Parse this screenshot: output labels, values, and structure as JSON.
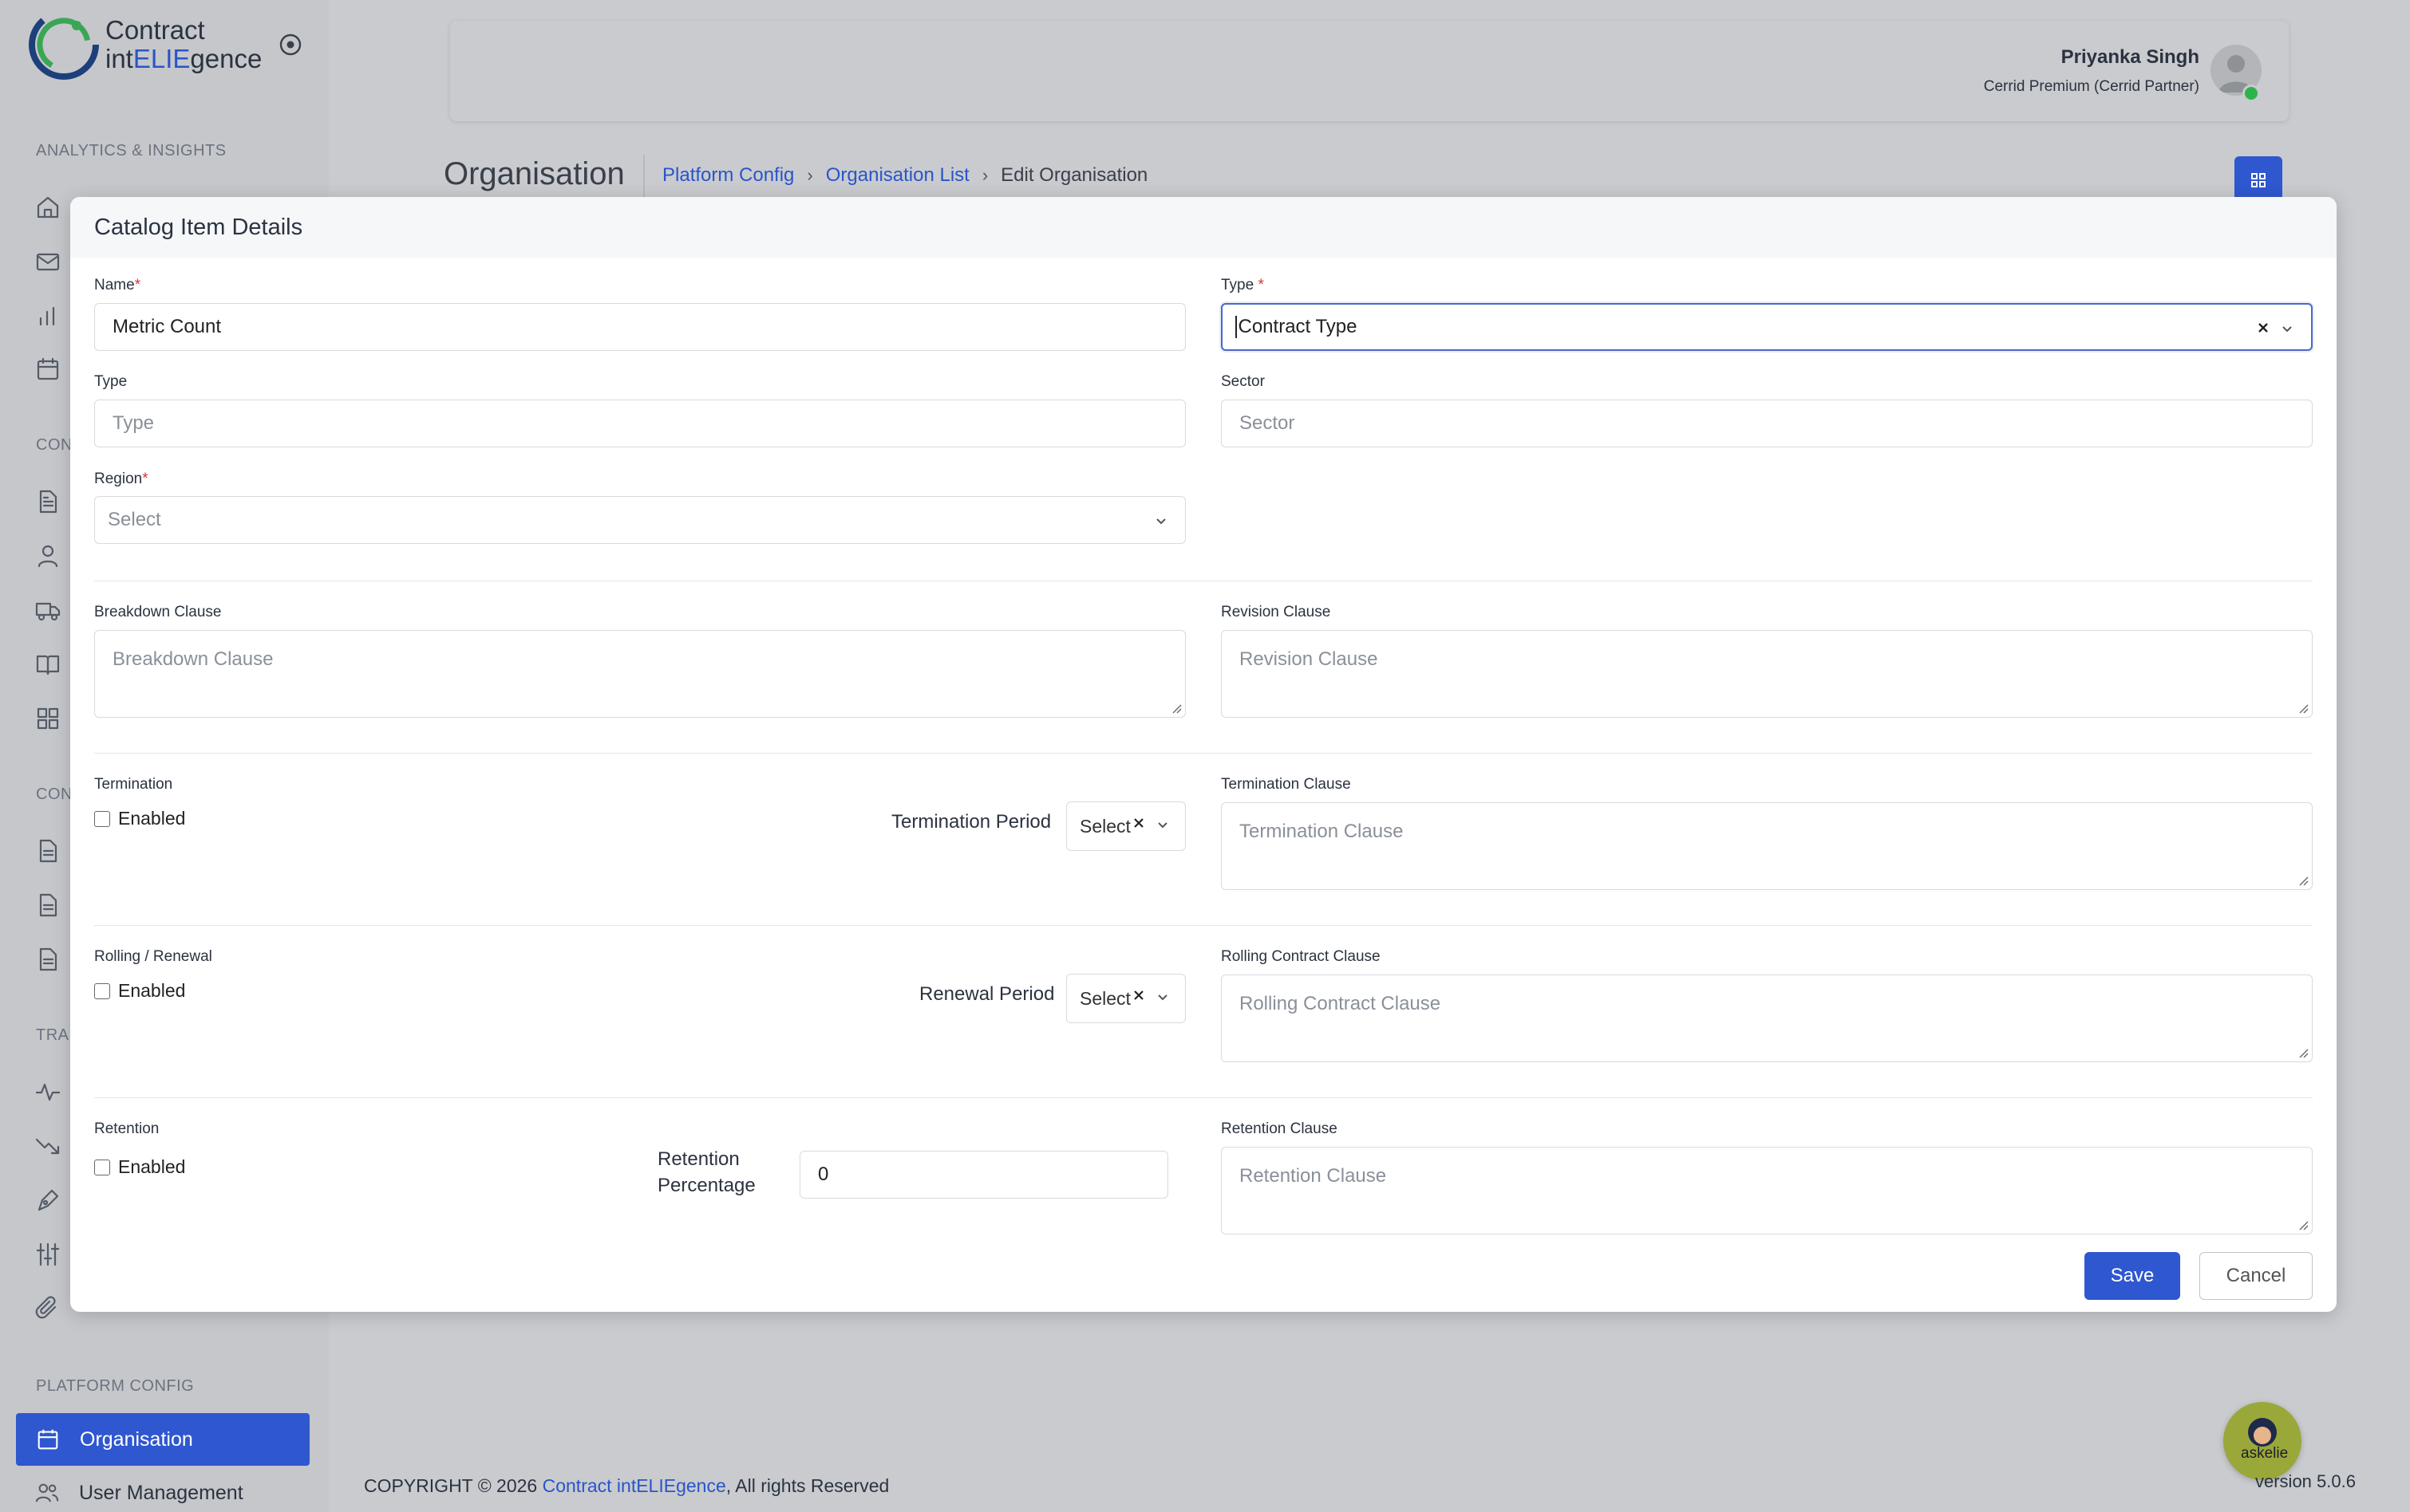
{
  "brand": {
    "logo_line1": "Contract",
    "logo_line2_pre": "int",
    "logo_line2_acc": "ELIE",
    "logo_line2_post": "gence"
  },
  "sidebar": {
    "headings": {
      "analytics": "ANALYTICS & INSIGHTS",
      "con1": "CON",
      "con2": "CON",
      "track": "TRA",
      "platform": "PLATFORM CONFIG"
    },
    "active_item": {
      "label": "Organisation",
      "icon": "calendar-icon"
    },
    "items": [
      {
        "label": "User Management",
        "icon": "users-icon"
      }
    ]
  },
  "header": {
    "user_name": "Priyanka Singh",
    "user_role": "Cerrid Premium (Cerrid Partner)",
    "page_title": "Organisation",
    "breadcrumb": [
      "Platform Config",
      "Organisation List",
      "Edit Organisation"
    ]
  },
  "modal": {
    "title": "Catalog Item Details",
    "name": {
      "label": "Name",
      "value": "Metric Count"
    },
    "type_select": {
      "label": "Type",
      "value": "Contract Type"
    },
    "type_input": {
      "label": "Type",
      "placeholder": "Type"
    },
    "sector": {
      "label": "Sector",
      "placeholder": "Sector"
    },
    "region": {
      "label": "Region",
      "placeholder": "Select"
    },
    "breakdown": {
      "label": "Breakdown Clause",
      "placeholder": "Breakdown Clause"
    },
    "revision": {
      "label": "Revision Clause",
      "placeholder": "Revision Clause"
    },
    "termination": {
      "label": "Termination",
      "checkbox": "Enabled",
      "period_label": "Termination Period",
      "period_value": "Select",
      "clause_label": "Termination Clause",
      "clause_placeholder": "Termination Clause"
    },
    "rolling": {
      "label": "Rolling / Renewal",
      "checkbox": "Enabled",
      "period_label": "Renewal Period",
      "period_value": "Select",
      "clause_label": "Rolling Contract Clause",
      "clause_placeholder": "Rolling Contract Clause"
    },
    "retention": {
      "label": "Retention",
      "checkbox": "Enabled",
      "pct_label_1": "Retention",
      "pct_label_2": "Percentage",
      "pct_value": "0",
      "clause_label": "Retention Clause",
      "clause_placeholder": "Retention Clause"
    },
    "save": "Save",
    "cancel": "Cancel"
  },
  "footer": {
    "copyright": "COPYRIGHT © 2026 ",
    "link": "Contract intELIEgence",
    "rights": ", All rights Reserved",
    "version": "version 5.0.6",
    "assistant": "askelie"
  },
  "colors": {
    "primary": "#2f57cf",
    "link": "#2a55c8",
    "required": "#e03131"
  }
}
